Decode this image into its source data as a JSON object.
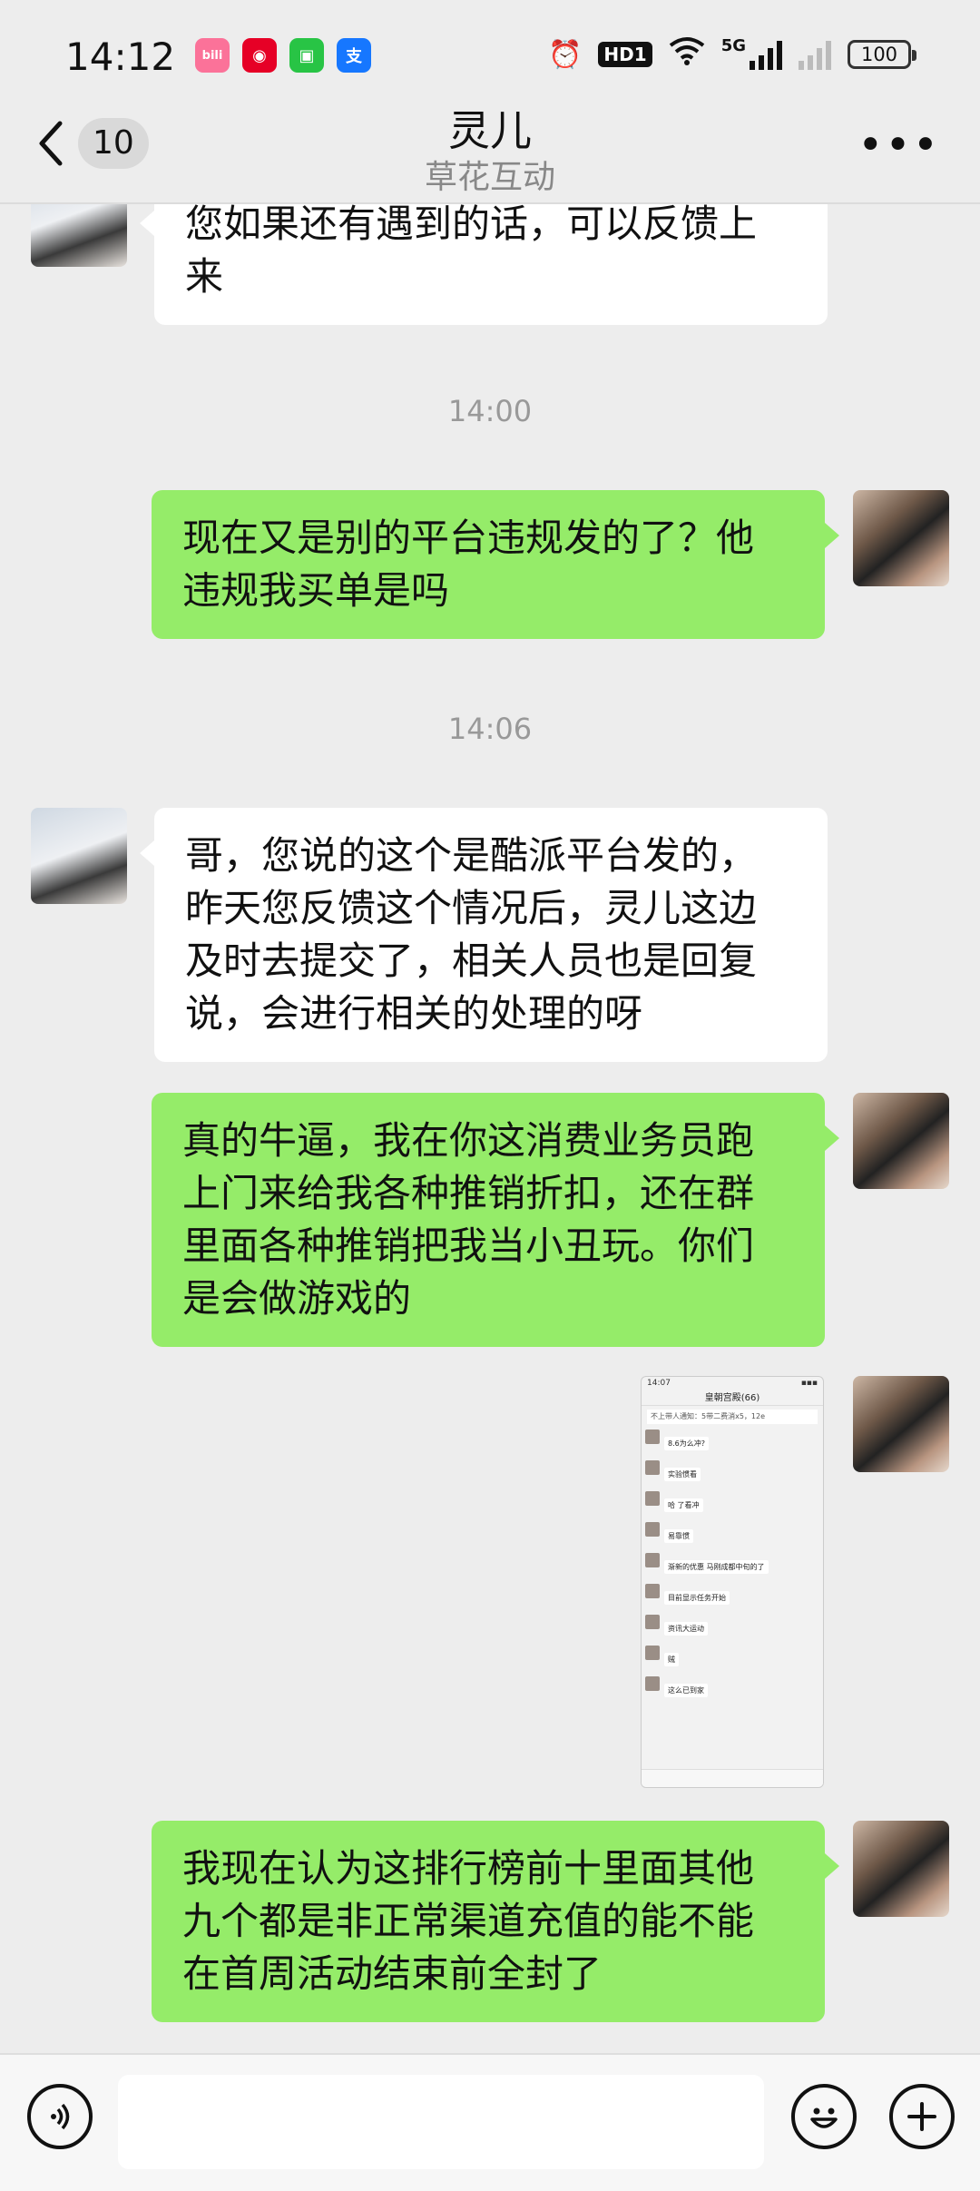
{
  "status_bar": {
    "time": "14:12",
    "apps": [
      {
        "name": "bilibili-icon",
        "glyph": "bili",
        "color": "#fb7299"
      },
      {
        "name": "netease-music-icon",
        "glyph": "◉",
        "color": "#e60026"
      },
      {
        "name": "messages-icon",
        "glyph": "▣",
        "color": "#28c445"
      },
      {
        "name": "alipay-icon",
        "glyph": "支",
        "color": "#1677ff"
      }
    ],
    "hd": "HD1",
    "network": "5G",
    "battery": "100"
  },
  "header": {
    "back_icon": "chevron-left-icon",
    "unread_count": "10",
    "title": "灵儿",
    "subtitle": "草花互动",
    "more_icon": "more-icon"
  },
  "messages": [
    {
      "side": "left",
      "text": "您如果还有遇到的话，可以反馈上\n来"
    },
    {
      "type": "time",
      "text": "14:00"
    },
    {
      "side": "right",
      "text": "现在又是别的平台违规发的了？他\n违规我买单是吗"
    },
    {
      "type": "time",
      "text": "14:06"
    },
    {
      "side": "left",
      "text": "哥，您说的这个是酷派平台发的，\n昨天您反馈这个情况后，灵儿这边\n及时去提交了，相关人员也是回复\n说，会进行相关的处理的呀"
    },
    {
      "side": "right",
      "text": "真的牛逼，我在你这消费业务员跑\n上门来给我各种推销折扣，还在群\n里面各种推销把我当小丑玩。你们\n是会做游戏的"
    },
    {
      "side": "right",
      "type": "image"
    },
    {
      "side": "right",
      "text": "我现在认为这排行榜前十里面其他\n九个都是非正常渠道充值的能不能\n在首周活动结束前全封了"
    }
  ],
  "screenshot": {
    "time": "14:07",
    "title": "皇朝宫殿(66)",
    "notice": "不上带人通知：5带二费消x5，12e",
    "rows": [
      "8.6为么冲?",
      "实验惯看",
      "哈 了看冲",
      "易靠惯",
      "渐新的优惠 马刚成都中旬的了",
      "目前显示任务开始",
      "资讯大运动",
      "贼",
      "这么已到家"
    ]
  },
  "input_bar": {
    "voice_icon": "voice-icon",
    "emoji_icon": "emoji-icon",
    "plus_icon": "plus-icon",
    "input_value": ""
  }
}
